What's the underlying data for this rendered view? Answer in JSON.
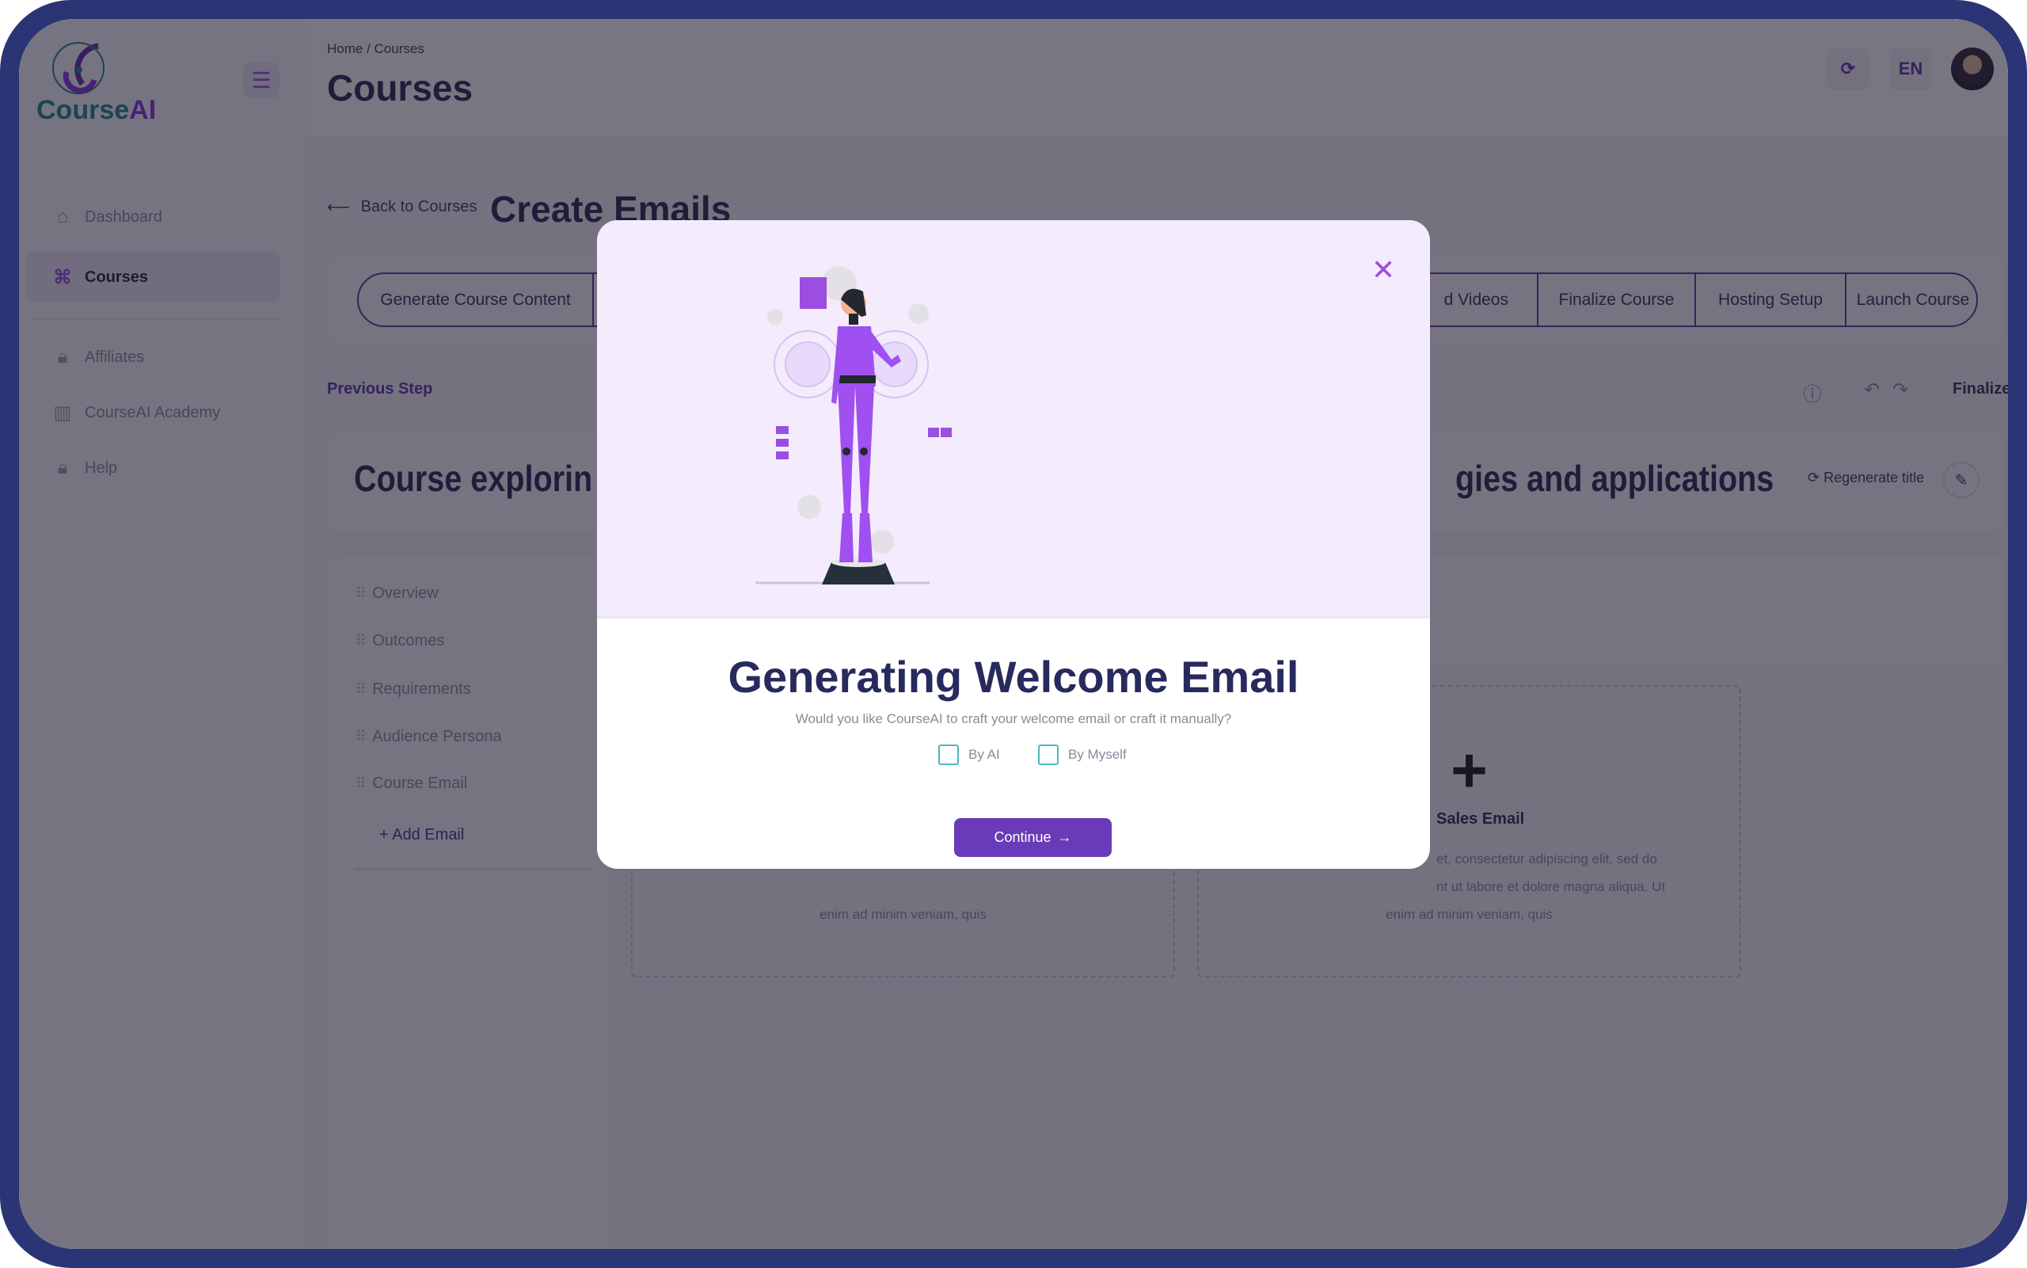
{
  "brand": {
    "name_main": "Course",
    "name_accent": "AI"
  },
  "sidebar": {
    "items": [
      {
        "label": "Dashboard",
        "icon": "home-icon"
      },
      {
        "label": "Courses",
        "icon": "command-icon",
        "active": true
      },
      {
        "label": "Affiliates",
        "icon": "lock-icon"
      },
      {
        "label": "CourseAI Academy",
        "icon": "book-icon"
      },
      {
        "label": "Help",
        "icon": "lock-icon"
      }
    ]
  },
  "header": {
    "breadcrumb": "Home / Courses",
    "title": "Courses",
    "language": "EN"
  },
  "page": {
    "back_label": "Back to Courses",
    "section_title": "Create Emails",
    "steps": [
      "Generate Course Content",
      "d Videos",
      "Finalize Course",
      "Hosting Setup",
      "Launch Course"
    ],
    "previous_step": "Previous Step",
    "finalize": "Finalize",
    "course_title_left": "Course explorin",
    "course_title_right": "gies and applications",
    "regenerate_title": "Regenerate title",
    "outline": [
      "Overview",
      "Outcomes",
      "Requirements",
      "Audience Persona",
      "Course Email"
    ],
    "add_email": "Add Email",
    "email_cards": [
      {
        "label": "",
        "lines": [
          "",
          "",
          "enim ad minim veniam, quis"
        ]
      },
      {
        "label": "Sales Email",
        "lines": [
          "et, consectetur adipiscing elit, sed do",
          "nt ut labore et dolore magna aliqua. Ut",
          "enim ad minim veniam, quis"
        ]
      }
    ]
  },
  "modal": {
    "title": "Generating Welcome Email",
    "subtitle": "Would you like CourseAI to craft your welcome email or craft it manually?",
    "options": [
      {
        "label": "By AI",
        "checked": false
      },
      {
        "label": "By Myself",
        "checked": false
      }
    ],
    "continue_label": "Continue",
    "accent": "#6a3bb8"
  }
}
